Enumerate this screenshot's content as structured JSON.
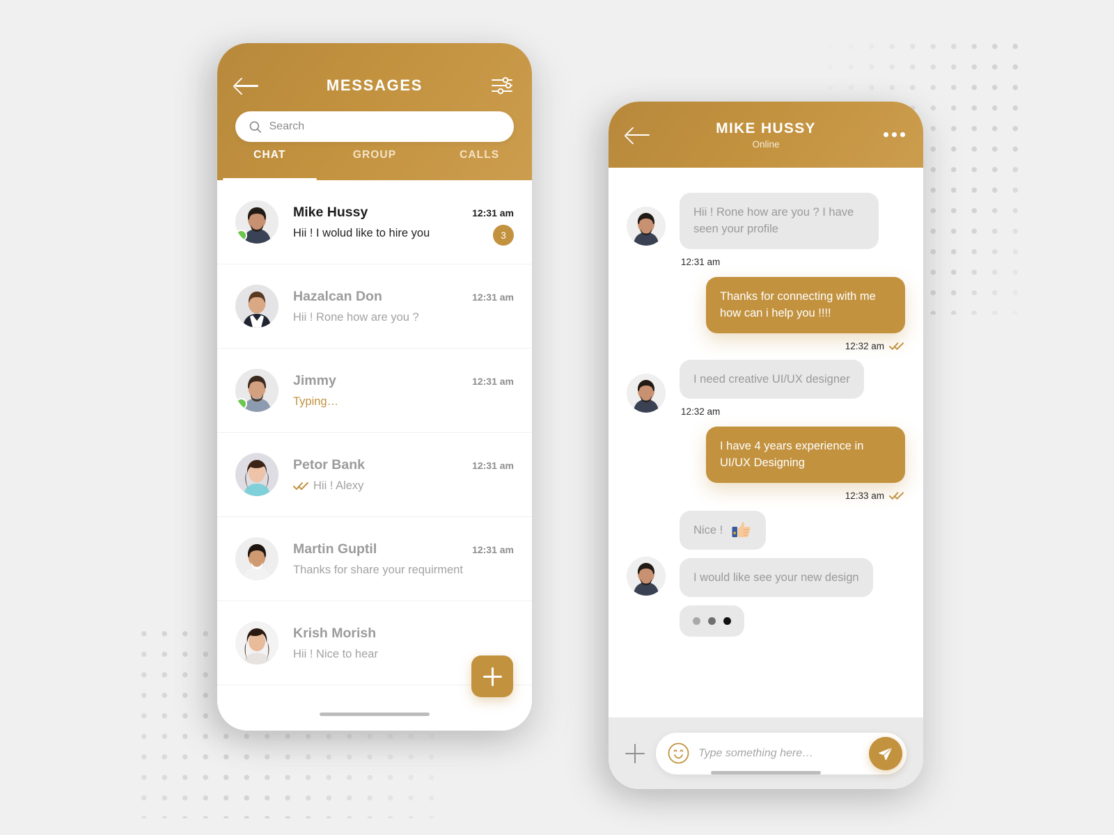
{
  "theme": {
    "brand_gold": "#C2923F",
    "brand_gold_dark": "#B8893C",
    "brand_gold_light": "#CC9D4E",
    "online_green": "#6DC64D",
    "bubble_grey": "#E8E8E8",
    "page_bg": "#F0F0F0"
  },
  "messages_screen": {
    "header": {
      "title": "MESSAGES",
      "back_icon": "arrow-left-icon",
      "filter_icon": "sliders-icon"
    },
    "search": {
      "placeholder": "Search",
      "value": "",
      "icon": "search-icon"
    },
    "tabs": [
      {
        "label": "CHAT",
        "active": true
      },
      {
        "label": "GROUP",
        "active": false
      },
      {
        "label": "CALLS",
        "active": false
      }
    ],
    "conversations": [
      {
        "name": "Mike Hussy",
        "preview": "Hii ! I wolud like to hire you",
        "time": "12:31 am",
        "unread_count": "3",
        "online": true,
        "unread": true,
        "typing": false,
        "has_ticks": false
      },
      {
        "name": "Hazalcan Don",
        "preview": "Hii ! Rone how are you ?",
        "time": "12:31 am",
        "unread_count": "",
        "online": false,
        "unread": false,
        "typing": false,
        "has_ticks": false
      },
      {
        "name": "Jimmy",
        "preview": "Typing…",
        "time": "12:31 am",
        "unread_count": "",
        "online": true,
        "unread": false,
        "typing": true,
        "has_ticks": false
      },
      {
        "name": "Petor Bank",
        "preview": "Hii !  Alexy",
        "time": "12:31 am",
        "unread_count": "",
        "online": false,
        "unread": false,
        "typing": false,
        "has_ticks": true
      },
      {
        "name": "Martin Guptil",
        "preview": "Thanks for share your requirment",
        "time": "12:31 am",
        "unread_count": "",
        "online": false,
        "unread": false,
        "typing": false,
        "has_ticks": false
      },
      {
        "name": "Krish Morish",
        "preview": "Hii ! Nice to hear",
        "time": "",
        "unread_count": "",
        "online": false,
        "unread": false,
        "typing": false,
        "has_ticks": false
      }
    ],
    "fab": {
      "icon": "plus-icon",
      "label": ""
    }
  },
  "conversation_screen": {
    "header": {
      "name": "MIKE HUSSY",
      "status": "Online",
      "back_icon": "arrow-left-icon",
      "menu_icon": "more-horizontal-icon"
    },
    "messages": [
      {
        "id": "m1",
        "side": "them",
        "text": "Hii ! Rone how are you ? I have seen your profile",
        "time": "12:31 am",
        "avatar": true,
        "read_ticks": false
      },
      {
        "id": "m2",
        "side": "me",
        "text": "Thanks for connecting with me how can i help you !!!!",
        "time": "12:32 am",
        "avatar": false,
        "read_ticks": true
      },
      {
        "id": "m3",
        "side": "them",
        "text": "I need creative UI/UX designer",
        "time": "12:32 am",
        "avatar": true,
        "read_ticks": false
      },
      {
        "id": "m4",
        "side": "me",
        "text": "I have 4 years experience in UI/UX Designing",
        "time": "12:33 am",
        "avatar": false,
        "read_ticks": true
      },
      {
        "id": "m5",
        "side": "them",
        "text": "Nice !",
        "emoji": "thumbs-up-emoji",
        "time": "",
        "avatar": false,
        "read_ticks": false
      },
      {
        "id": "m6",
        "side": "them",
        "text": "I would like see your new design",
        "time": "",
        "avatar": true,
        "read_ticks": false
      },
      {
        "id": "m7",
        "side": "them",
        "text": "",
        "typing_indicator": true,
        "time": "",
        "avatar": false,
        "read_ticks": false
      }
    ],
    "composer": {
      "placeholder": "Type something here…",
      "value": "",
      "attach_icon": "plus-icon",
      "emoji_icon": "smiley-icon",
      "send_icon": "send-icon"
    }
  }
}
